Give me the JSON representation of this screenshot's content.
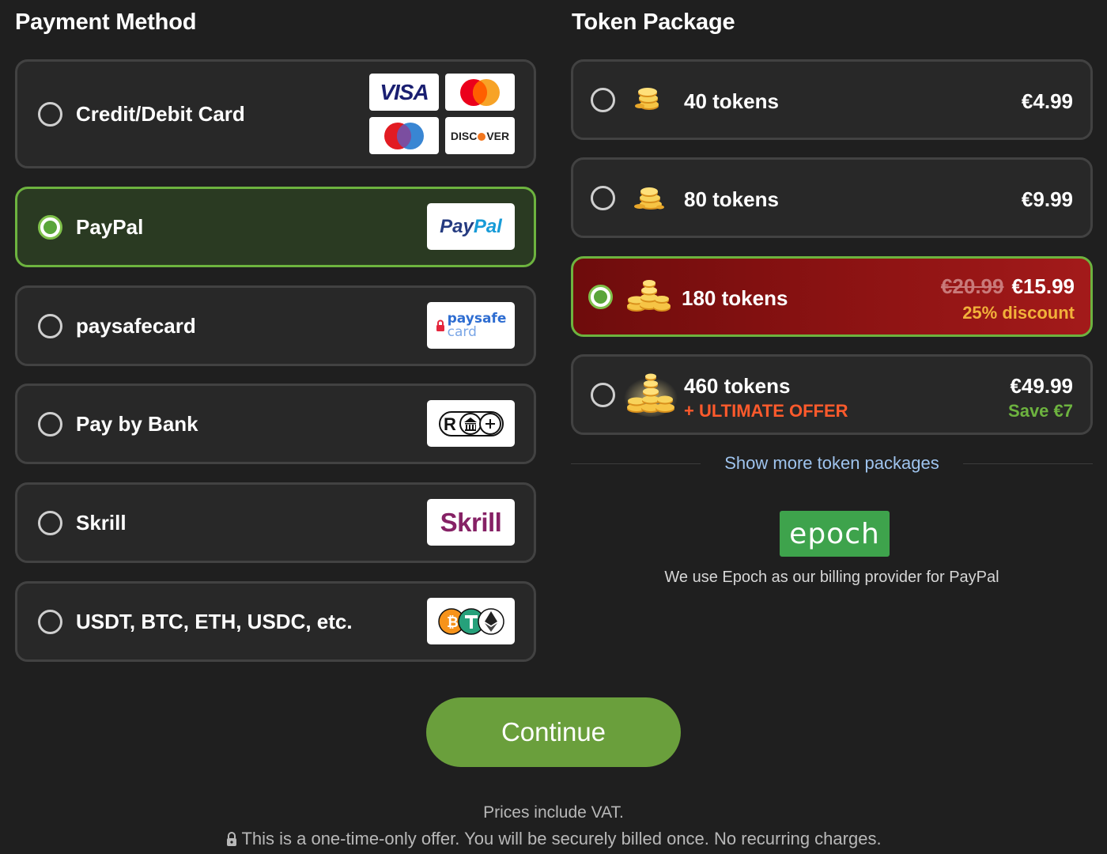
{
  "payment": {
    "title": "Payment Method",
    "methods": [
      {
        "label": "Credit/Debit Card",
        "selected": false,
        "logos": [
          "visa-logo",
          "mastercard-logo",
          "maestro-logo",
          "discover-logo"
        ]
      },
      {
        "label": "PayPal",
        "selected": true,
        "logo": "paypal-logo"
      },
      {
        "label": "paysafecard",
        "selected": false,
        "logo": "paysafecard-logo"
      },
      {
        "label": "Pay by Bank",
        "selected": false,
        "logo": "pay-by-bank-logo"
      },
      {
        "label": "Skrill",
        "selected": false,
        "logo": "skrill-logo"
      },
      {
        "label": "USDT, BTC, ETH, USDC, etc.",
        "selected": false,
        "logo": "crypto-logos"
      }
    ],
    "logo_text": {
      "visa": "VISA",
      "discover_pre": "DISC",
      "discover_post": "VER",
      "paypal_a": "Pay",
      "paypal_b": "Pal",
      "paysafe_top": "paysafe",
      "paysafe_bottom": "card",
      "skrill": "Skrill"
    }
  },
  "tokens": {
    "title": "Token Package",
    "packages": [
      {
        "name": "40 tokens",
        "price": "€4.99",
        "selected": false
      },
      {
        "name": "80 tokens",
        "price": "€9.99",
        "selected": false
      },
      {
        "name": "180 tokens",
        "old_price": "€20.99",
        "price": "€15.99",
        "note": "25% discount",
        "selected": true
      },
      {
        "name": "460 tokens",
        "tag": "+ ULTIMATE OFFER",
        "price": "€49.99",
        "note": "Save €7",
        "selected": false
      }
    ],
    "show_more": "Show more token packages"
  },
  "billing": {
    "provider_logo": "epoch",
    "note": "We use Epoch as our billing provider for PayPal"
  },
  "continue_label": "Continue",
  "footer": {
    "vat": "Prices include VAT.",
    "one_time": "This is a one-time-only offer. You will be securely billed once. No recurring charges."
  },
  "colors": {
    "background": "#1f1f1f",
    "card": "#282828",
    "selected_border": "#6db33f",
    "selected_green_bg": "#2a3a22",
    "selected_red_bg": "#8a1212",
    "accent_gold": "#f2b13a",
    "accent_orange": "#ff5a2c",
    "accent_green": "#6db33f",
    "link": "#9fc4ee",
    "continue": "#6a9f3c"
  }
}
